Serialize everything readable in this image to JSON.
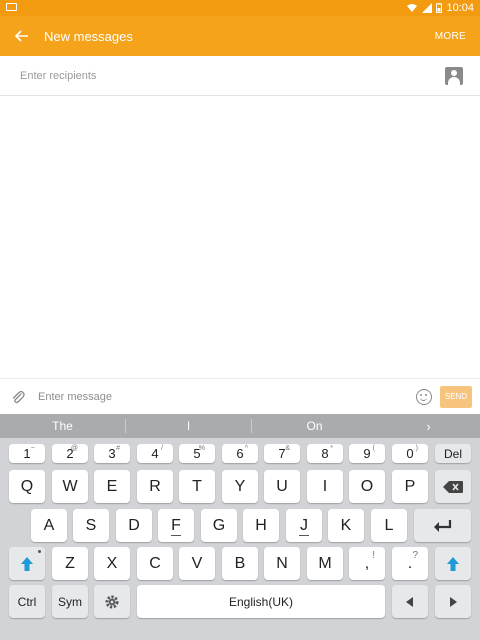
{
  "status_bar": {
    "time": "10:04",
    "icons": [
      "wifi-icon",
      "signal-icon",
      "battery-icon"
    ]
  },
  "app_bar": {
    "title": "New messages",
    "more_label": "MORE",
    "back_icon": "back-arrow-icon",
    "color": "#f5a31b"
  },
  "recipients": {
    "placeholder": "Enter recipients",
    "icon": "contact-icon"
  },
  "composer": {
    "placeholder": "Enter message",
    "send_label": "SEND",
    "attach_icon": "paperclip-icon",
    "emoji_icon": "emoji-icon"
  },
  "keyboard": {
    "suggestions": [
      "The",
      "I",
      "On"
    ],
    "number_row": [
      {
        "main": "1",
        "sup": "~"
      },
      {
        "main": "2",
        "sup": "@"
      },
      {
        "main": "3",
        "sup": "#"
      },
      {
        "main": "4",
        "sup": "/"
      },
      {
        "main": "5",
        "sup": "%"
      },
      {
        "main": "6",
        "sup": "^"
      },
      {
        "main": "7",
        "sup": "&"
      },
      {
        "main": "8",
        "sup": "*"
      },
      {
        "main": "9",
        "sup": "("
      },
      {
        "main": "0",
        "sup": ")"
      }
    ],
    "delete_label": "Del",
    "row1": [
      "Q",
      "W",
      "E",
      "R",
      "T",
      "Y",
      "U",
      "I",
      "O",
      "P"
    ],
    "row2": [
      "A",
      "S",
      "D",
      "F",
      "G",
      "H",
      "J",
      "K",
      "L"
    ],
    "row3": [
      "Z",
      "X",
      "C",
      "V",
      "B",
      "N",
      "M"
    ],
    "comma": {
      "main": ",",
      "sup": "!"
    },
    "period": {
      "main": ".",
      "sup": "?"
    },
    "ctrl_label": "Ctrl",
    "sym_label": "Sym",
    "space_label": "English(UK)"
  }
}
